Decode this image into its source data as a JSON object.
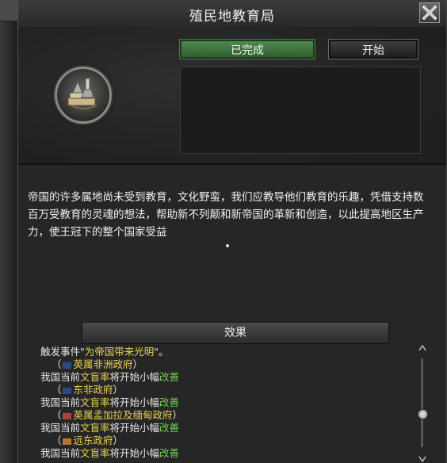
{
  "window": {
    "title": "殖民地教育局",
    "close_icon": "close-x-icon"
  },
  "decision": {
    "emblem_icon": "education-emblem-icon",
    "status_button": "已完成",
    "start_button": "开始",
    "description": "帝国的许多属地尚未受到教育，文化野蛮，我们应教导他们教育的乐趣，凭借支持数百万受教育的灵魂的想法，帮助新不列颠和新帝国的革新和创造，以此提高地区生产力，使王冠下的整个国家受益",
    "description_end": "。"
  },
  "effects": {
    "header": "效果",
    "trigger": {
      "prefix": "触发事件\"",
      "event": "为帝国带来光明",
      "suffix": "\"。"
    },
    "prefix": "我国当前",
    "stat": "文盲率",
    "middle": "将开始小幅",
    "result": "改善",
    "open_paren": "（",
    "close_paren": "）",
    "governments": [
      {
        "name": "英属非洲政府",
        "flag_color": "#2a4a8a"
      },
      {
        "name": "东非政府",
        "flag_color": "#2a4a8a"
      },
      {
        "name": "英属孟加拉及缅甸政府",
        "flag_color": "#b04040"
      },
      {
        "name": "远东政府",
        "flag_color": "#c07030"
      }
    ]
  },
  "colors": {
    "highlight_yellow": "#e8d44d",
    "highlight_green": "#6fcf4a",
    "done_button_green": "#3e7a3e"
  }
}
